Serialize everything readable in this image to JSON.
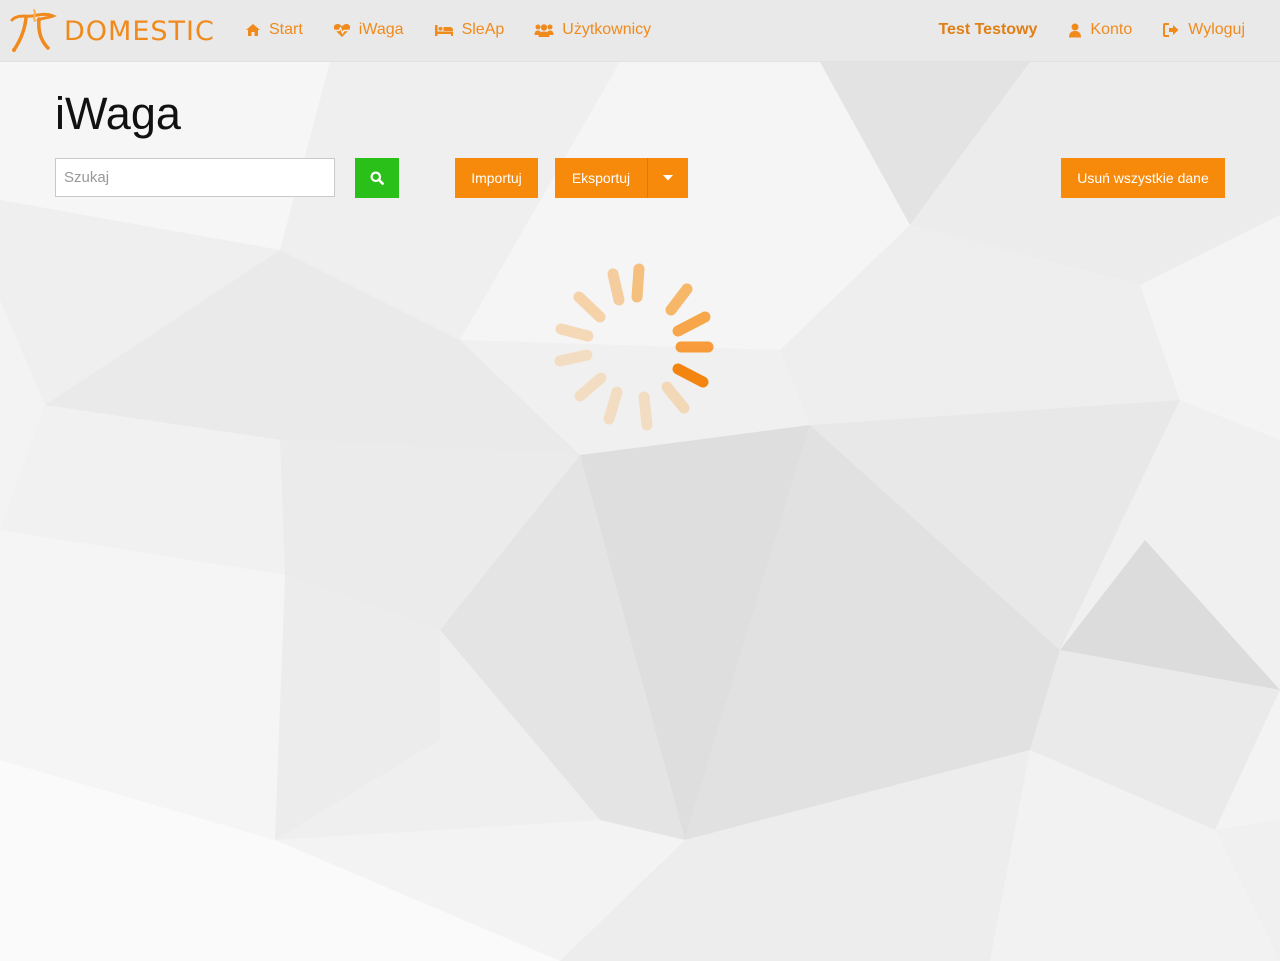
{
  "brand": {
    "name": "DOMESTIC",
    "logo_icon": "pi-flame-logo"
  },
  "nav": {
    "left": [
      {
        "label": "Start",
        "icon": "home-icon"
      },
      {
        "label": "iWaga",
        "icon": "heartbeat-icon"
      },
      {
        "label": "SleAp",
        "icon": "bed-icon"
      },
      {
        "label": "Użytkownicy",
        "icon": "users-icon"
      }
    ],
    "user_name": "Test Testowy",
    "account": {
      "label": "Konto",
      "icon": "user-icon"
    },
    "logout": {
      "label": "Wyloguj",
      "icon": "sign-out-icon"
    }
  },
  "page": {
    "title": "iWaga",
    "search_placeholder": "Szukaj",
    "import_label": "Importuj",
    "export_label": "Eksportuj",
    "delete_all_label": "Usuń wszystkie dane"
  },
  "colors": {
    "accent": "#f78a0b",
    "search_button": "#2bbf19",
    "title": "#111111"
  },
  "status": {
    "loading": true,
    "spinner_icon": "loading-spinner-icon"
  }
}
